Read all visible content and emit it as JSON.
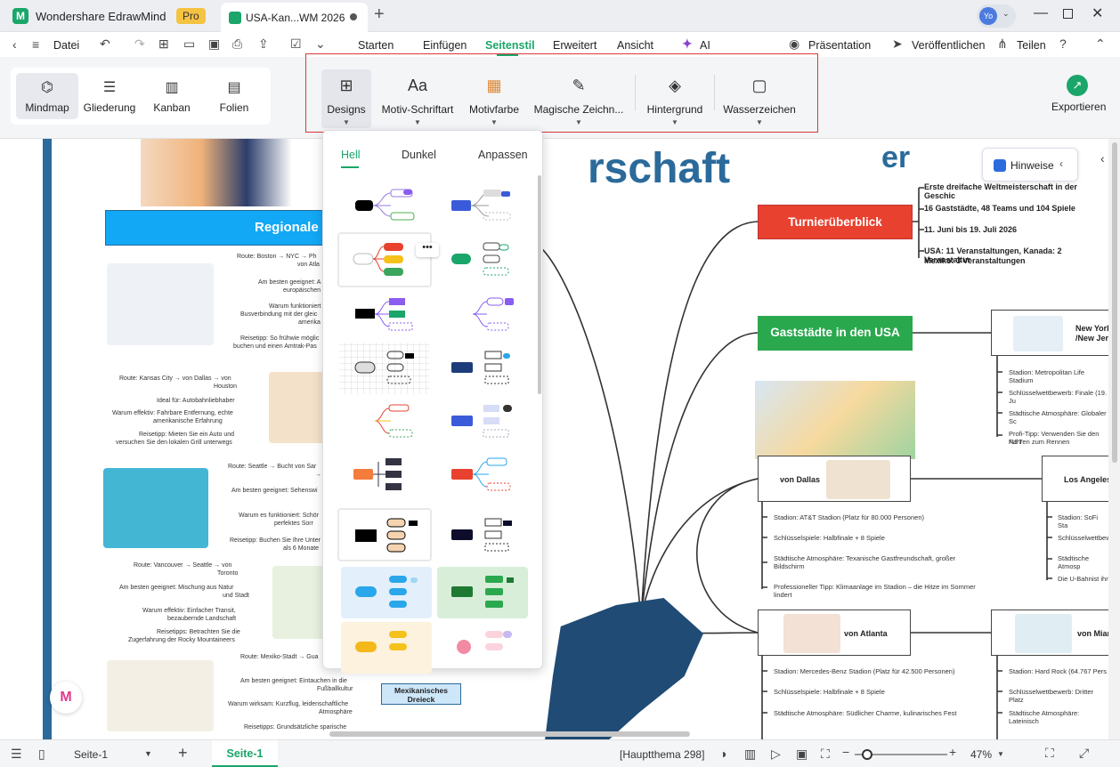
{
  "app": {
    "logo": "M",
    "name": "Wondershare EdrawMind",
    "badge": "Pro"
  },
  "doc_tab": {
    "label": "USA-Kan...WM 2026"
  },
  "user": {
    "initials": "Yo"
  },
  "menu": {
    "datei": "Datei",
    "tabs": [
      "Starten",
      "Einfügen",
      "Seitenstil",
      "Erweitert",
      "Ansicht",
      "AI"
    ],
    "presentation": "Präsentation",
    "publish": "Veröffentlichen",
    "share": "Teilen"
  },
  "views": [
    "Mindmap",
    "Gliederung",
    "Kanban",
    "Folien"
  ],
  "tools": [
    "Designs",
    "Motiv-Schriftart",
    "Motivfarbe",
    "Magische Zeichn...",
    "Hintergrund",
    "Wasserzeichen"
  ],
  "export": "Exportieren",
  "designs_panel": {
    "tabs": [
      "Hell",
      "Dunkel",
      "Anpassen"
    ],
    "more": "•••"
  },
  "canvas": {
    "title_fragment": "rschaft",
    "title_fragment2": "er",
    "hints": "Hinweise",
    "regional": "Regionale R",
    "turnier": "Turnierüberblick",
    "turnier_details": [
      "Erste dreifache Weltmeisterschaft in der Geschic",
      "16 Gaststädte, 48 Teams und 104 Spiele",
      "11. Juni bis 19. Juli 2026",
      "USA: 11 Veranstaltungen, Kanada: 2 Veranstaltur",
      "Mexiko: 3 Veranstaltungen"
    ],
    "gaststaedte": "Gaststädte in den USA",
    "newyork": "New York\n/New Jer",
    "newyork_details": [
      "Stadion: Metropolitan Life Stadium",
      "Schlüsselwettbewerb: Finale (19. Ju",
      "Städtische Atmosphäre: Globaler Sc",
      "Profi-Tipp: Verwenden Sie den NJ T",
      "Fahren zum Rennen"
    ],
    "dallas": "von Dallas",
    "dallas_details": [
      "Stadion: AT&T Stadion (Platz für 80.000 Personen)",
      "Schlüsselspiele: Halbfinale + 8 Spiele",
      "Städtische Atmosphäre: Texanische Gastfreundschaft, großer",
      "Bildschirm",
      "Professioneller Tipp: Klimaanlage im Stadion – die Hitze im Sommer",
      "lindert"
    ],
    "losangeles": "Los Angeles",
    "la_details": [
      "Stadion: SoFi Sta",
      "Schlüsselwettbew",
      "Städtische Atmosp",
      "Die U-Bahnist ihr"
    ],
    "atlanta": "von Atlanta",
    "atlanta_details": [
      "Stadion: Mercedes-Benz Stadion (Platz für 42.500 Personen)",
      "Schlüsselspiele: Halbfinale + 8 Spiele",
      "Städtische Atmosphäre: Südlicher Charme, kulinarisches Fest"
    ],
    "miami": "von Mian",
    "miami_details": [
      "Stadion: Hard Rock (64.767 Pers",
      "Schlüsselwettbewerb: Dritter Platz",
      "Städtische Atmosphäre: Lateinisch"
    ],
    "mex_node": "Mexikanisches Dreieck",
    "left_texts": [
      "Route: Boston → NYC → Ph",
      "von Atla",
      "Am besten geeignet: A",
      "europäischen",
      "Warum funktioniert",
      "Busverbindung mit der gleic",
      "amerika",
      "Reisetipp: So frühwie möglic",
      "buchen und einen Amtrak-Pas",
      "Route: Kansas City → von Dallas → von",
      "Houston",
      "Ideal für: Autobahnliebhaber",
      "Warum effektiv: Fahrbare Entfernung, echte",
      "amerikanische Erfahrung",
      "Reisetipp: Mieten Sie ein Auto und",
      "versuchen Sie den lokalen Grill unterwegs",
      "Route: Seattle → Bucht von Sar",
      "→ L",
      "Am besten geeignet: Sehenswi",
      "Warum es funktioniert: Schör",
      "perfektes Sorr",
      "Reisetipp: Buchen Sie Ihre Unter",
      "als 6 Monate",
      "Route: Vancouver → Seattle → von",
      "Toronto",
      "Am besten geeignet: Mischung aus Natur",
      "und Stadt",
      "Warum effektiv: Einfacher Transit,",
      "bezaubernde Landschaft",
      "Reisetipps: Betrachten Sie die",
      "Zugerfahrung der Rocky Mountaineers",
      "Route: Mexiko-Stadt → Gua",
      "Am besten geeignet: Eintauchen in die",
      "Fußballkultur",
      "Warum wirksam: Kurzflug, leidenschaftliche",
      "Atmosphäre",
      "Reisetipps: Grundsätzliche sparische"
    ]
  },
  "status": {
    "page_select": "Seite-1",
    "page_tab": "Seite-1",
    "topic": "[Hauptthema 298]",
    "zoom": "47%",
    "zoom_level": 0.47
  }
}
